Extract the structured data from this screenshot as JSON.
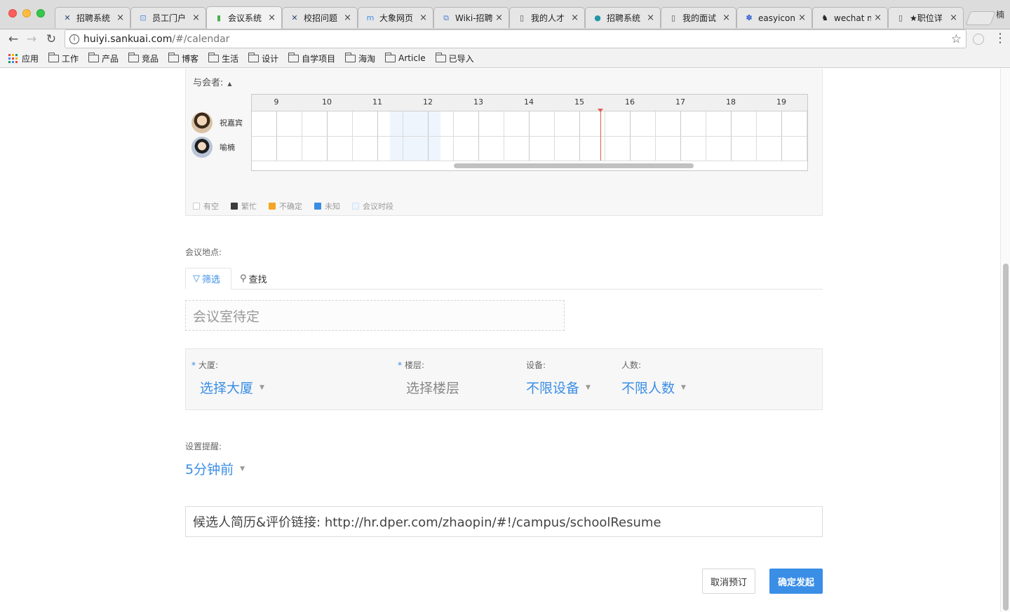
{
  "browser": {
    "tabs": [
      {
        "label": "招聘系统",
        "icon": "x-logo-icon",
        "color": "#2b4a7a",
        "glyph": "✕",
        "active": false
      },
      {
        "label": "员工门户",
        "icon": "portal-icon",
        "color": "#4a87d6",
        "glyph": "⊡",
        "active": false
      },
      {
        "label": "会议系统",
        "icon": "calendar-app-icon",
        "color": "#4caf50",
        "glyph": "▮",
        "active": true
      },
      {
        "label": "校招问题",
        "icon": "x-logo-icon",
        "color": "#2b4a7a",
        "glyph": "✕",
        "active": false
      },
      {
        "label": "大象网页",
        "icon": "elephant-icon",
        "color": "#3a8ee6",
        "glyph": "m",
        "active": false
      },
      {
        "label": "Wiki-招聘",
        "icon": "wiki-icon",
        "color": "#4a7fd6",
        "glyph": "⧉",
        "active": false
      },
      {
        "label": "我的人才",
        "icon": "document-icon",
        "color": "#555555",
        "glyph": "▯",
        "active": false
      },
      {
        "label": "招聘系统",
        "icon": "globe-icon",
        "color": "#2196a8",
        "glyph": "●",
        "active": false
      },
      {
        "label": "我的面试",
        "icon": "document-icon",
        "color": "#555555",
        "glyph": "▯",
        "active": false
      },
      {
        "label": "easyicon",
        "icon": "paw-icon",
        "color": "#2f5bd3",
        "glyph": "✽",
        "active": false
      },
      {
        "label": "wechat m",
        "icon": "github-icon",
        "color": "#222222",
        "glyph": "♞",
        "active": false
      },
      {
        "label": "★职位详",
        "icon": "document-icon",
        "color": "#555555",
        "glyph": "▯",
        "active": false
      }
    ],
    "close_glyph": "×",
    "profile_name": "楠",
    "url_host": "huiyi.sankuai.com",
    "url_path": "/#/calendar",
    "info_glyph": "i",
    "star_glyph": "☆",
    "back_glyph": "←",
    "forward_glyph": "→",
    "reload_glyph": "↻",
    "menu_glyph": "⋮",
    "bookmarks": [
      {
        "label": "应用",
        "icon": "apps-grid-icon"
      },
      {
        "label": "工作",
        "icon": "folder-icon"
      },
      {
        "label": "产品",
        "icon": "folder-icon"
      },
      {
        "label": "竞品",
        "icon": "folder-icon"
      },
      {
        "label": "博客",
        "icon": "folder-icon"
      },
      {
        "label": "生活",
        "icon": "folder-icon"
      },
      {
        "label": "设计",
        "icon": "folder-icon"
      },
      {
        "label": "自学项目",
        "icon": "folder-icon"
      },
      {
        "label": "海淘",
        "icon": "folder-icon"
      },
      {
        "label": "Article",
        "icon": "folder-icon"
      },
      {
        "label": "已导入",
        "icon": "folder-icon"
      }
    ]
  },
  "attendees": {
    "title": "与会者:",
    "caret": "▲",
    "hours": [
      "9",
      "10",
      "11",
      "12",
      "13",
      "14",
      "15",
      "16",
      "17",
      "18",
      "19"
    ],
    "people": [
      {
        "name": "祝嘉宾",
        "avatar": "avatar-icon"
      },
      {
        "name": "喻楠",
        "avatar": "avatar-icon"
      }
    ],
    "meeting_slot_hours": [
      11.25,
      12.25
    ],
    "current_time_hour": 15.42,
    "legend": [
      {
        "label": "有空",
        "color": "#ffffff",
        "border": "#cccccc"
      },
      {
        "label": "繁忙",
        "color": "#3c3c3c",
        "border": "#3c3c3c"
      },
      {
        "label": "不确定",
        "color": "#f5a623",
        "border": "#f5a623"
      },
      {
        "label": "未知",
        "color": "#3a8ee6",
        "border": "#3a8ee6"
      },
      {
        "label": "会议时段",
        "color": "#eef5fd",
        "border": "#cfe0f5"
      }
    ]
  },
  "location": {
    "label": "会议地点:",
    "tab_filter": "筛选",
    "tab_search": "查找",
    "filter_glyph": "▽",
    "search_glyph": "⚲",
    "room_pending": "会议室待定"
  },
  "filters": {
    "building": {
      "label": "大厦:",
      "value": "选择大厦",
      "required": true
    },
    "floor": {
      "label": "楼层:",
      "value": "选择楼层",
      "required": true
    },
    "device": {
      "label": "设备:",
      "value": "不限设备",
      "required": false
    },
    "people": {
      "label": "人数:",
      "value": "不限人数",
      "required": false
    },
    "required_mark": "*",
    "dropdown_glyph": "▼"
  },
  "reminder": {
    "label": "设置提醒:",
    "value": "5分钟前"
  },
  "resume_link": "候选人简历&评价链接:  http://hr.dper.com/zhaopin/#!/campus/schoolResume",
  "buttons": {
    "cancel": "取消预订",
    "confirm": "确定发起"
  },
  "colors": {
    "accent": "#3a8ee6",
    "now_line": "#e25b52"
  }
}
